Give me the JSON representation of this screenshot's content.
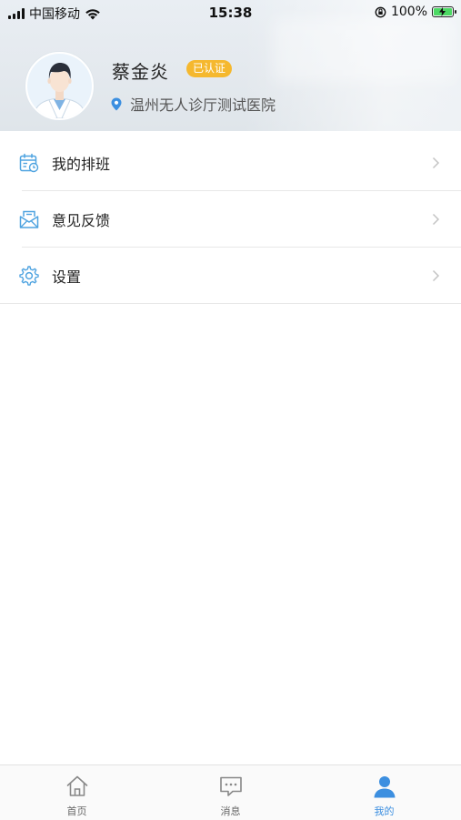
{
  "status_bar": {
    "carrier": "中国移动",
    "time": "15:38",
    "battery_percent": "100%"
  },
  "profile": {
    "name": "蔡金炎",
    "badge": "已认证",
    "hospital": "温州无人诊厅测试医院"
  },
  "menu": {
    "items": [
      {
        "label": "我的排班",
        "icon": "calendar-schedule-icon"
      },
      {
        "label": "意见反馈",
        "icon": "feedback-mail-icon"
      },
      {
        "label": "设置",
        "icon": "gear-icon"
      }
    ]
  },
  "tabs": [
    {
      "label": "首页",
      "icon": "home-icon",
      "active": false
    },
    {
      "label": "消息",
      "icon": "message-icon",
      "active": false
    },
    {
      "label": "我的",
      "icon": "person-icon",
      "active": true
    }
  ],
  "colors": {
    "accent": "#3c8fe0",
    "icon_blue": "#4ea3e0",
    "badge": "#f5b82e"
  }
}
